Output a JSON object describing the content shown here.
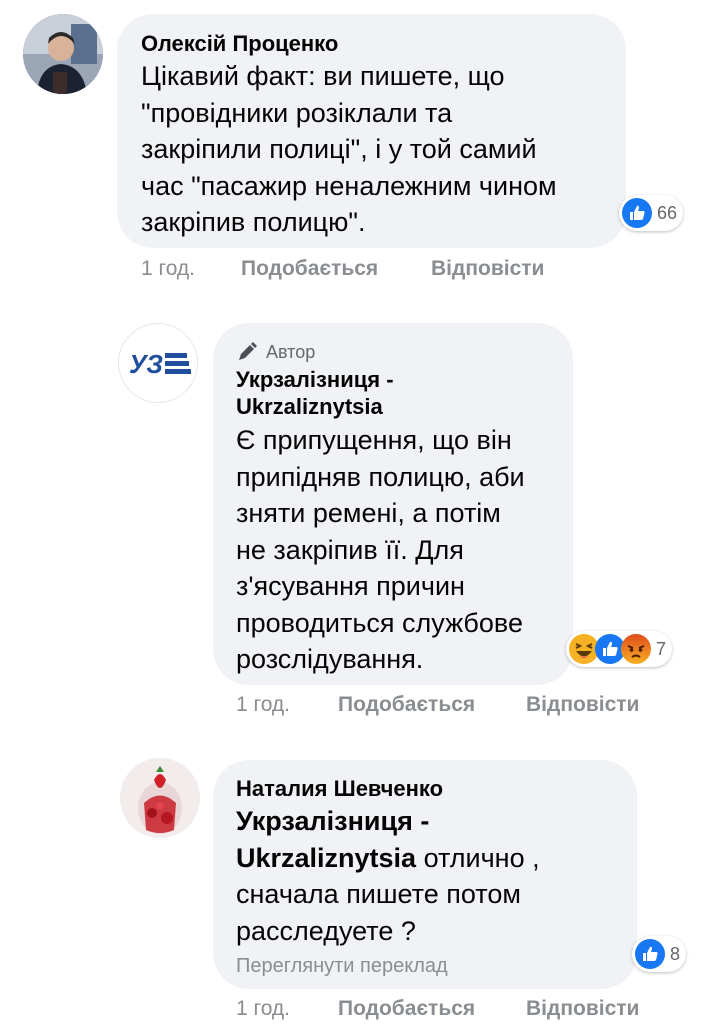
{
  "comments": [
    {
      "author": "Олексій Проценко",
      "lines": [
        "Цікавий факт: ви пишете, що",
        "\"провідники розіклали та",
        "закріпили полиці\", і у той самий",
        "час \"пасажир неналежним чином",
        "закріпив полицю\"."
      ],
      "reaction_count": "66",
      "time": "1 год.",
      "like_label": "Подобається",
      "reply_label": "Відповісти"
    },
    {
      "badge_label": "Автор",
      "author_line1": "Укрзалізниця -",
      "author_line2": "Ukrzaliznytsia",
      "avatar_logo_text": "УЗ",
      "lines": [
        "Є припущення, що він",
        "припідняв полицю, аби",
        "зняти ремені, а потім",
        "не закріпив її. Для",
        "з'ясування причин",
        "проводиться службове",
        "розслідування."
      ],
      "reaction_count": "7",
      "time": "1 год.",
      "like_label": "Подобається",
      "reply_label": "Відповісти"
    },
    {
      "author": "Наталия Шевченко",
      "mention_line1": "Укрзалізниця -",
      "mention_line2": "Ukrzaliznytsia",
      "line2_rest": " отлично ,",
      "lines": [
        "сначала пишете потом",
        "расследуете ?"
      ],
      "translate_label": "Переглянути переклад",
      "reaction_count": "8",
      "time": "1 год.",
      "like_label": "Подобається",
      "reply_label": "Відповісти"
    }
  ],
  "colors": {
    "bubble": "#f0f2f5",
    "like_blue": "#1877f2",
    "meta_gray": "#8a8d91",
    "angry": "#e9710f",
    "haha": "#f7b125",
    "uz_blue": "#1f4e9c"
  },
  "icons": {
    "like": "like-icon",
    "haha": "haha-icon",
    "angry": "angry-icon",
    "pencil": "pencil-icon"
  }
}
